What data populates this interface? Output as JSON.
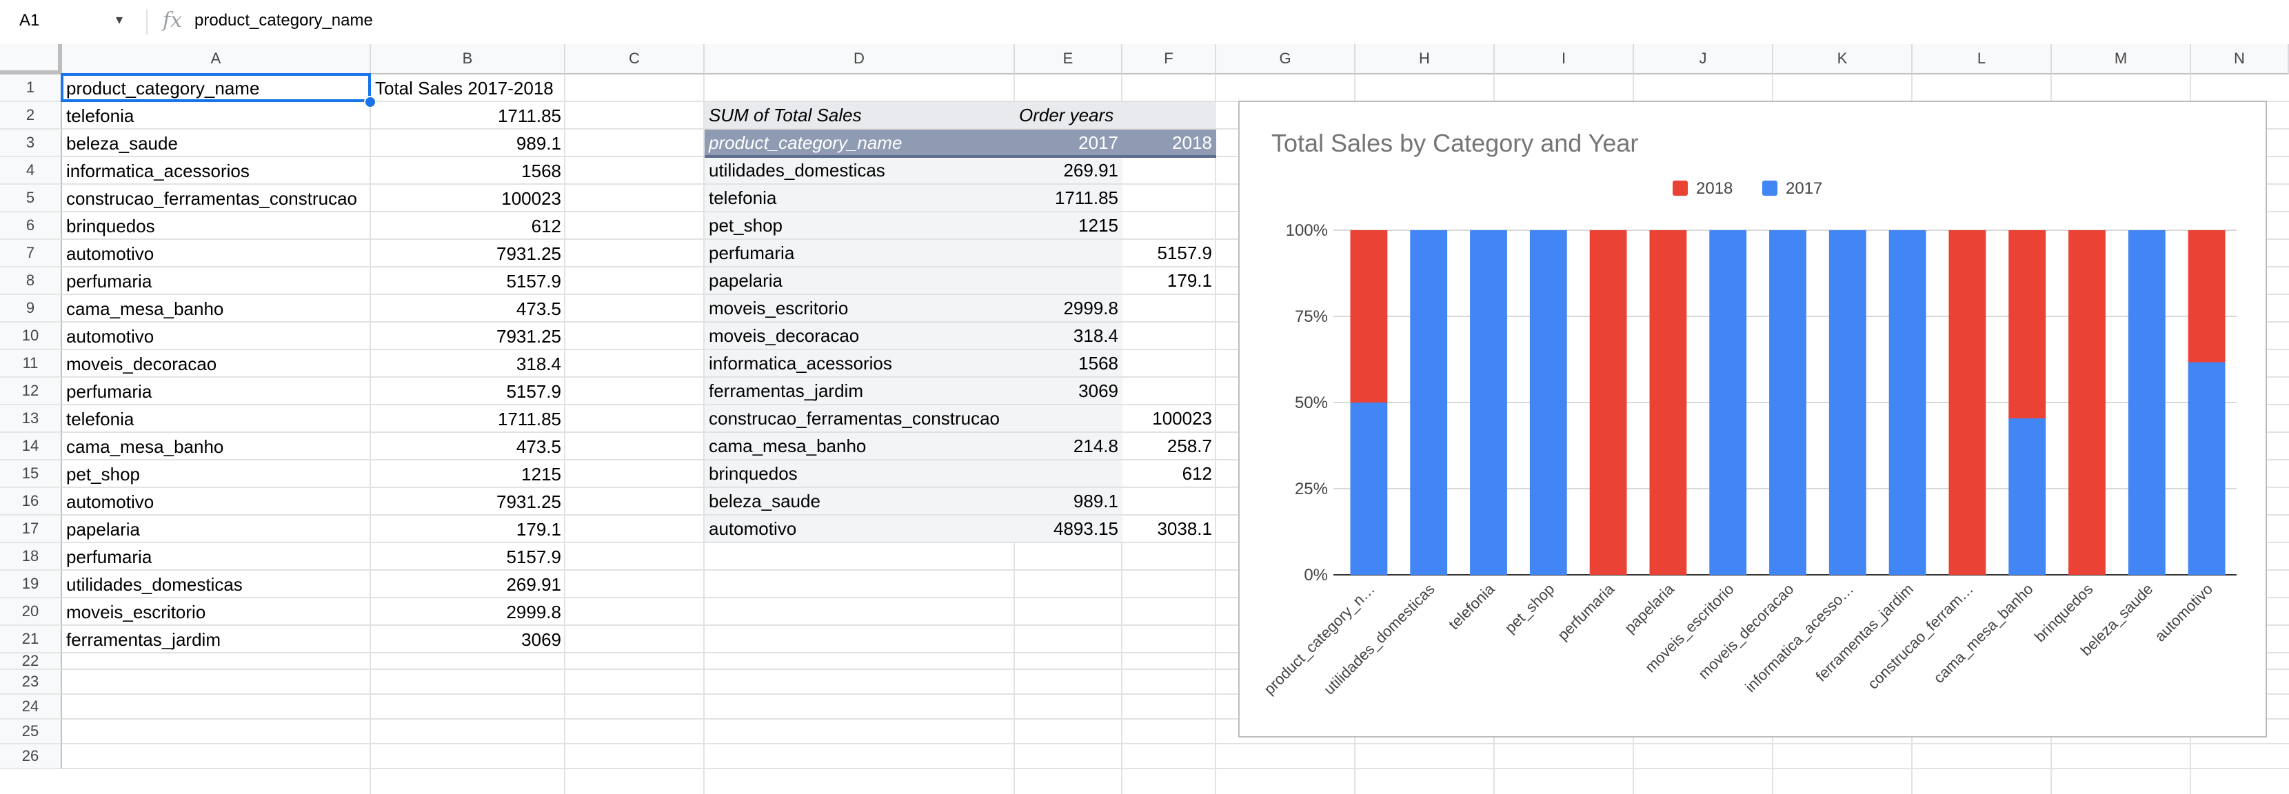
{
  "formula_bar": {
    "name_box": "A1",
    "caret": "▾",
    "fx_icon": "fx",
    "content": "product_category_name"
  },
  "columns": [
    "A",
    "B",
    "C",
    "D",
    "E",
    "F",
    "G",
    "H",
    "I",
    "J",
    "K",
    "L",
    "M",
    "N"
  ],
  "rows": [
    "1",
    "2",
    "3",
    "4",
    "5",
    "6",
    "7",
    "8",
    "9",
    "10",
    "11",
    "12",
    "13",
    "14",
    "15",
    "16",
    "17",
    "18",
    "19",
    "20",
    "21",
    "22",
    "23",
    "24",
    "25",
    "26"
  ],
  "colA": [
    "product_category_name",
    "telefonia",
    "beleza_saude",
    "informatica_acessorios",
    "construcao_ferramentas_construcao",
    "brinquedos",
    "automotivo",
    "perfumaria",
    "cama_mesa_banho",
    "automotivo",
    "moveis_decoracao",
    "perfumaria",
    "telefonia",
    "cama_mesa_banho",
    "pet_shop",
    "automotivo",
    "papelaria",
    "perfumaria",
    "utilidades_domesticas",
    "moveis_escritorio",
    "ferramentas_jardim"
  ],
  "colB": [
    "Total Sales 2017-2018",
    "1711.85",
    "989.1",
    "1568",
    "100023",
    "612",
    "7931.25",
    "5157.9",
    "473.5",
    "7931.25",
    "318.4",
    "5157.9",
    "1711.85",
    "473.5",
    "1215",
    "7931.25",
    "179.1",
    "5157.9",
    "269.91",
    "2999.8",
    "3069"
  ],
  "pivot": {
    "title": "SUM of Total Sales",
    "order_years": "Order years",
    "row_header": "product_category_name",
    "years": [
      "2017",
      "2018"
    ],
    "rows": [
      [
        "utilidades_domesticas",
        "269.91",
        ""
      ],
      [
        "telefonia",
        "1711.85",
        ""
      ],
      [
        "pet_shop",
        "1215",
        ""
      ],
      [
        "perfumaria",
        "",
        "5157.9"
      ],
      [
        "papelaria",
        "",
        "179.1"
      ],
      [
        "moveis_escritorio",
        "2999.8",
        ""
      ],
      [
        "moveis_decoracao",
        "318.4",
        ""
      ],
      [
        "informatica_acessorios",
        "1568",
        ""
      ],
      [
        "ferramentas_jardim",
        "3069",
        ""
      ],
      [
        "construcao_ferramentas_construcao",
        "",
        "100023"
      ],
      [
        "cama_mesa_banho",
        "214.8",
        "258.7"
      ],
      [
        "brinquedos",
        "",
        "612"
      ],
      [
        "beleza_saude",
        "989.1",
        ""
      ],
      [
        "automotivo",
        "4893.15",
        "3038.1"
      ]
    ]
  },
  "chart_data": {
    "type": "bar",
    "stacked": "percent",
    "title": "Total Sales by Category and Year",
    "legend_position": "top",
    "categories": [
      "product_category_n…",
      "utilidades_domesticas",
      "telefonia",
      "pet_shop",
      "perfumaria",
      "papelaria",
      "moveis_escritorio",
      "moveis_decoracao",
      "informatica_acesso…",
      "ferramentas_jardim",
      "construcao_ferram…",
      "cama_mesa_banho",
      "brinquedos",
      "beleza_saude",
      "automotivo"
    ],
    "series": [
      {
        "name": "2018",
        "color": "#ea4335",
        "values": [
          50,
          0,
          0,
          0,
          100,
          100,
          0,
          0,
          0,
          0,
          100,
          54.6,
          100,
          0,
          38.3
        ]
      },
      {
        "name": "2017",
        "color": "#4285f4",
        "values": [
          50,
          100,
          100,
          100,
          0,
          0,
          100,
          100,
          100,
          100,
          0,
          45.4,
          0,
          100,
          61.7
        ]
      }
    ],
    "y_ticks": [
      "0%",
      "25%",
      "50%",
      "75%",
      "100%"
    ],
    "ylim": [
      0,
      100
    ],
    "grid": true
  }
}
